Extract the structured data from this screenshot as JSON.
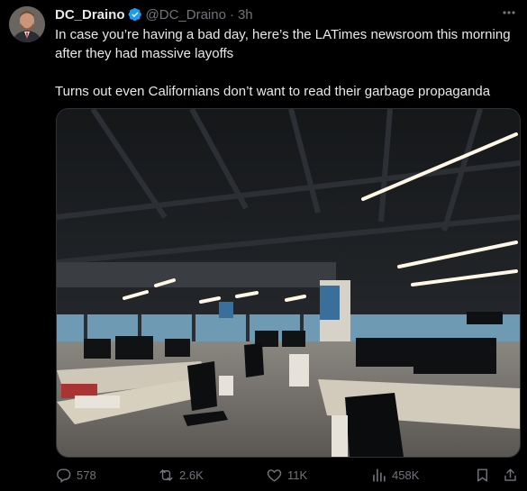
{
  "author": {
    "name": "DC_Draino",
    "handle": "@DC_Draino",
    "time": "3h",
    "verified": true
  },
  "tweet": {
    "line1": "In case you’re having a bad day, here’s the LATimes newsroom this morning after they had massive layoffs",
    "line2": "Turns out even Californians don’t want to read their garbage propaganda"
  },
  "media": {
    "icon": "photo-empty-office-newsroom"
  },
  "actions": {
    "replies": "578",
    "reposts": "2.6K",
    "likes": "11K",
    "views": "458K"
  },
  "colors": {
    "background": "#000000",
    "text": "#e7e9ea",
    "muted": "#71767b",
    "verified": "#1d9bf0"
  }
}
